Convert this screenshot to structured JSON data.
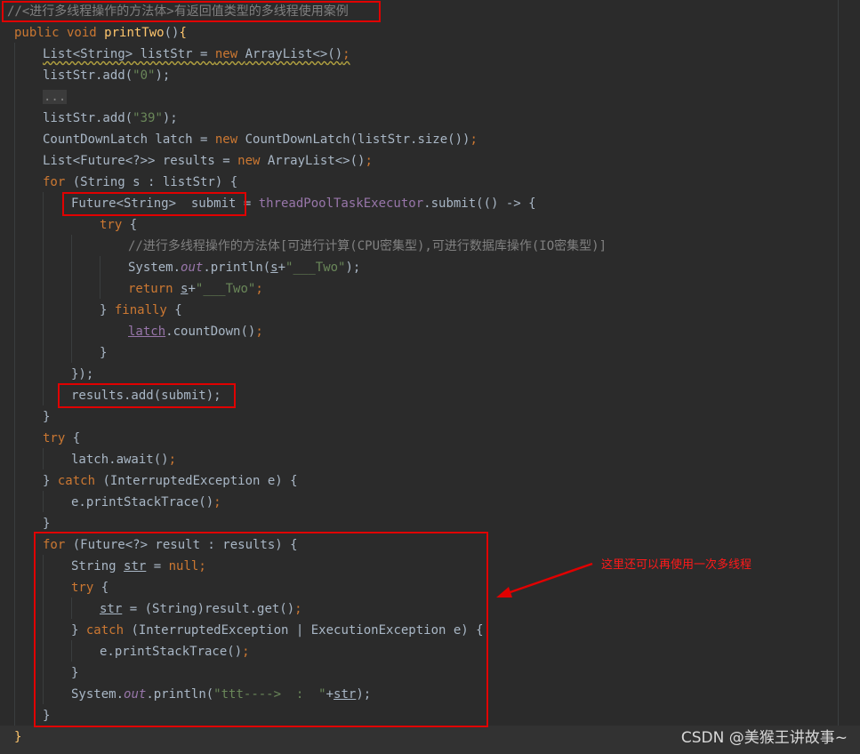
{
  "header_comment": "//<进行多线程操作的方法体>有返回值类型的多线程使用案例",
  "code": {
    "l1_kw": "public void ",
    "l1_fn": "printTwo",
    "l1_paren": "()",
    "l1_brace": "{",
    "l2_type": "List<String> listStr",
    "l2_eq": " = ",
    "l2_new": "new ",
    "l2_cls": "ArrayList<>()",
    "l2_semi": ";",
    "l3_a": "listStr.add(",
    "l3_str": "\"0\"",
    "l3_b": ");",
    "l4_fold": "...",
    "l5_a": "listStr.add(",
    "l5_str": "\"39\"",
    "l5_b": ");",
    "l6_a": "CountDownLatch latch = ",
    "l6_new": "new ",
    "l6_b": "CountDownLatch(listStr.size())",
    "l6_semi": ";",
    "l7_a": "List<Future<?>> results = ",
    "l7_new": "new ",
    "l7_b": "ArrayList<>()",
    "l7_semi": ";",
    "l8_kw": "for ",
    "l8_b": "(String s : listStr) {",
    "l9_a": "Future<String>  submit = ",
    "l9_fld": "threadPoolTaskExecutor",
    "l9_b": ".submit(() -> {",
    "l10_kw": "try ",
    "l10_b": "{",
    "l11_cmt": "//进行多线程操作的方法体[可进行计算(CPU密集型),可进行数据库操作(IO密集型)]",
    "l12_a": "System.",
    "l12_out": "out",
    "l12_b": ".println(",
    "l12_s": "s",
    "l12_plus": "+",
    "l12_str": "\"___Two\"",
    "l12_c": ");",
    "l13_kw": "return ",
    "l13_s": "s",
    "l13_plus": "+",
    "l13_str": "\"___Two\"",
    "l13_semi": ";",
    "l14_a": "} ",
    "l14_kw": "finally ",
    "l14_b": "{",
    "l15_latch": "latch",
    "l15_b": ".countDown()",
    "l15_semi": ";",
    "l16": "}",
    "l17": "});",
    "l18": "results.add(submit);",
    "l19": "}",
    "l20_kw": "try ",
    "l20_b": "{",
    "l21_a": "latch.await()",
    "l21_semi": ";",
    "l22_a": "} ",
    "l22_kw": "catch ",
    "l22_b": "(InterruptedException e) {",
    "l23_a": "e.printStackTrace()",
    "l23_semi": ";",
    "l24": "}",
    "l25_kw": "for ",
    "l25_b": "(Future<?> result : results) {",
    "l26_a": "String ",
    "l26_str_var": "str",
    "l26_b": " = ",
    "l26_null": "null",
    "l26_semi": ";",
    "l27_kw": "try ",
    "l27_b": "{",
    "l28_var": "str",
    "l28_b": " = (String)result.get()",
    "l28_semi": ";",
    "l29_a": "} ",
    "l29_kw": "catch ",
    "l29_b": "(InterruptedException | ExecutionException e) {",
    "l30_a": "e.printStackTrace()",
    "l30_semi": ";",
    "l31": "}",
    "l32_a": "System.",
    "l32_out": "out",
    "l32_b": ".println(",
    "l32_str": "\"ttt---->  :  \"",
    "l32_plus": "+",
    "l32_var": "str",
    "l32_c": ");",
    "l33": "}",
    "l34": "}"
  },
  "annotation": "这里还可以再使用一次多线程",
  "watermark": "CSDN @美猴王讲故事~",
  "colors": {
    "background": "#2b2b2b",
    "keyword": "#cc7832",
    "method": "#ffc66d",
    "string": "#6a8759",
    "comment": "#808080",
    "field": "#9876aa",
    "highlight_box": "#e00000"
  }
}
